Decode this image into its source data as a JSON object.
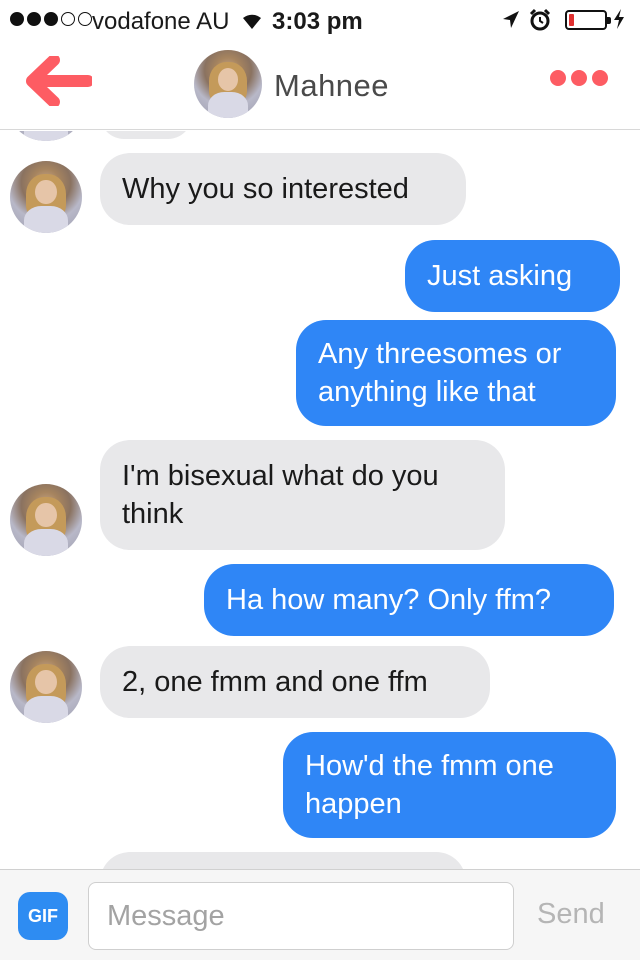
{
  "status_bar": {
    "carrier": "vodafone AU",
    "time": "3:03 pm",
    "signal_bars_filled": 3,
    "signal_bars_total": 5,
    "battery_level": 0.15,
    "battery_color": "#e03030"
  },
  "nav": {
    "contact_name": "Mahnee",
    "back_icon": "back-arrow-icon",
    "more_icon": "more-dots-icon",
    "accent_color": "#fd5c63"
  },
  "messages": [
    {
      "from": "them",
      "text": "Why you so interested"
    },
    {
      "from": "me",
      "text": "Just asking"
    },
    {
      "from": "me",
      "text": "Any threesomes or anything like that"
    },
    {
      "from": "them",
      "text": "I'm bisexual what do you think"
    },
    {
      "from": "me",
      "text": "Ha how many? Only ffm?"
    },
    {
      "from": "them",
      "text": "2, one fmm and one ffm"
    },
    {
      "from": "me",
      "text": "How'd the fmm one happen"
    }
  ],
  "composer": {
    "gif_label": "GIF",
    "placeholder": "Message",
    "send_label": "Send"
  },
  "colors": {
    "sent_bubble": "#2f86f6",
    "received_bubble": "#e8e8ea"
  }
}
